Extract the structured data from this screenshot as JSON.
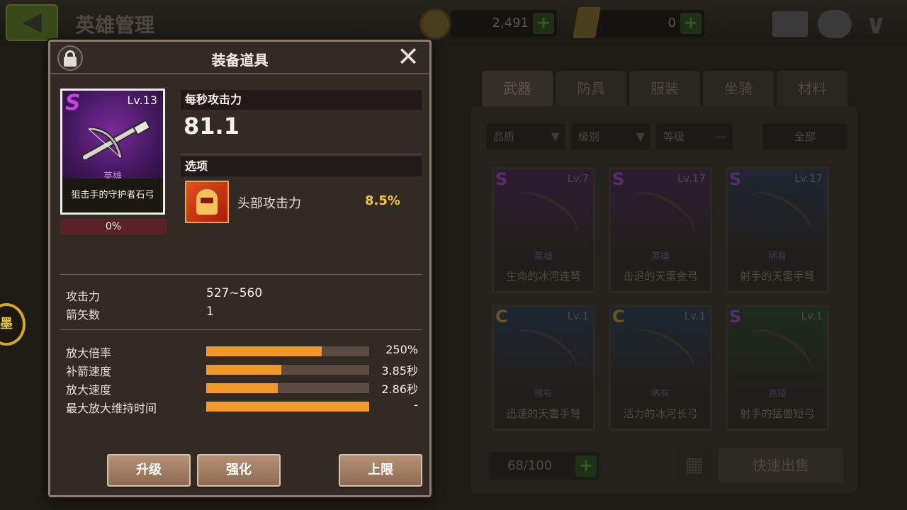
{
  "background": {
    "page_title": "英雄管理",
    "gold_amount": "2,491",
    "gem_amount": "0",
    "side_badge": "墨",
    "tabs": [
      "武器",
      "防具",
      "服装",
      "坐骑",
      "材料"
    ],
    "filters": {
      "quality": "品质",
      "grade": "级别",
      "level": "等级",
      "level_value": "—",
      "all": "全部"
    },
    "items": [
      {
        "grade": "S",
        "level": "Lv.7",
        "rarity": "英雄",
        "name": "生命的冰河连弩",
        "color": "#4a1a66"
      },
      {
        "grade": "S",
        "level": "Lv.17",
        "rarity": "英雄",
        "name": "击退的天雷金弓",
        "color": "#4a1a66"
      },
      {
        "grade": "S",
        "level": "Lv.17",
        "rarity": "稀有",
        "name": "射手的天雷手弩",
        "color": "#1a3a66"
      },
      {
        "grade": "C",
        "level": "Lv.1",
        "rarity": "稀有",
        "name": "迅速的天雷手弩",
        "color": "#1a3a66"
      },
      {
        "grade": "C",
        "level": "Lv.1",
        "rarity": "稀有",
        "name": "活力的冰河长弓",
        "color": "#1a3a66"
      },
      {
        "grade": "S",
        "level": "Lv.1",
        "rarity": "高级",
        "name": "射手的猛兽短弓",
        "color": "#1a4a26"
      }
    ],
    "capacity": "68/100",
    "sell_button": "快速出售"
  },
  "modal": {
    "title": "装备道具",
    "weapon": {
      "grade": "S",
      "level": "Lv.13",
      "rarity": "英雄",
      "name": "狙击手的守护者石弓",
      "progress": "0%"
    },
    "dps_label": "每秒攻击力",
    "dps_value": "81.1",
    "options_label": "选项",
    "option": {
      "label": "头部攻击力",
      "value": "8.5%"
    },
    "stats": [
      {
        "label": "攻击力",
        "value": "527~560"
      },
      {
        "label": "箭矢数",
        "value": "1"
      }
    ],
    "bars": [
      {
        "label": "放大倍率",
        "value": "250%",
        "fill": 0.71
      },
      {
        "label": "补箭速度",
        "value": "3.85秒",
        "fill": 0.46
      },
      {
        "label": "放大速度",
        "value": "2.86秒",
        "fill": 0.44
      },
      {
        "label": "最大放大维持时间",
        "value": "-",
        "fill": 1.0
      }
    ],
    "buttons": {
      "upgrade": "升级",
      "enhance": "强化",
      "limit": "上限"
    }
  },
  "colors": {
    "accent_orange": "#f39727",
    "option_gold": "#f4c437",
    "hero_purple": "#c83fe8"
  }
}
